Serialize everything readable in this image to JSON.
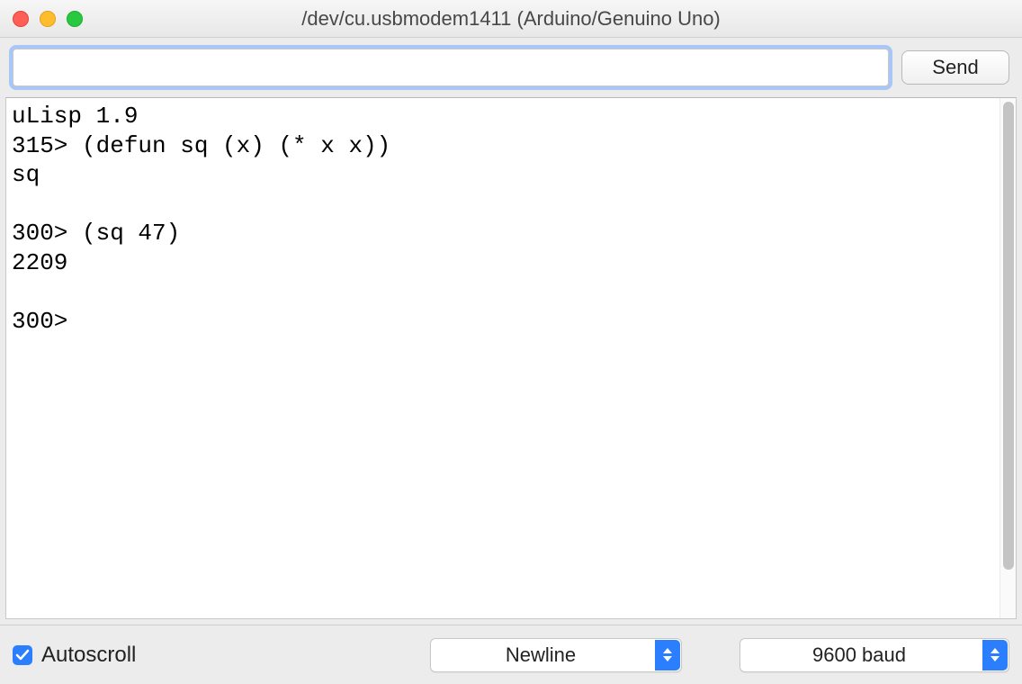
{
  "window": {
    "title": "/dev/cu.usbmodem1411 (Arduino/Genuino Uno)"
  },
  "toolbar": {
    "command_value": "",
    "command_placeholder": "",
    "send_label": "Send"
  },
  "console": {
    "text": "uLisp 1.9\n315> (defun sq (x) (* x x))\nsq\n\n300> (sq 47)\n2209\n\n300> "
  },
  "bottombar": {
    "autoscroll_label": "Autoscroll",
    "autoscroll_checked": true,
    "line_ending_selected": "Newline",
    "baud_selected": "9600 baud"
  }
}
